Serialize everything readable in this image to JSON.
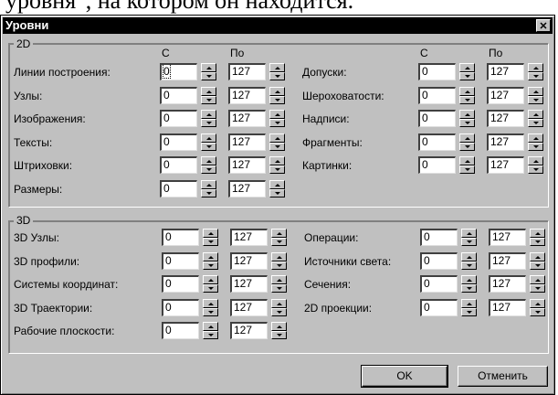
{
  "doc_text": "уровня\", на котором он находится.",
  "dialog": {
    "title": "Уровни",
    "close_glyph": "✕",
    "ok_label": "OK",
    "cancel_label": "Отменить"
  },
  "group_2d": {
    "label": "2D",
    "col_from": "С",
    "col_to": "По",
    "col_from_right": "С",
    "col_to_right": "По",
    "left_rows": [
      {
        "label": "Линии построения:",
        "from": "0",
        "to": "127"
      },
      {
        "label": "Узлы:",
        "from": "0",
        "to": "127"
      },
      {
        "label": "Изображения:",
        "from": "0",
        "to": "127"
      },
      {
        "label": "Тексты:",
        "from": "0",
        "to": "127"
      },
      {
        "label": "Штриховки:",
        "from": "0",
        "to": "127"
      },
      {
        "label": "Размеры:",
        "from": "0",
        "to": "127"
      }
    ],
    "right_rows": [
      {
        "label": "Допуски:",
        "from": "0",
        "to": "127"
      },
      {
        "label": "Шероховатости:",
        "from": "0",
        "to": "127"
      },
      {
        "label": "Надписи:",
        "from": "0",
        "to": "127"
      },
      {
        "label": "Фрагменты:",
        "from": "0",
        "to": "127"
      },
      {
        "label": "Картинки:",
        "from": "0",
        "to": "127"
      }
    ]
  },
  "group_3d": {
    "label": "3D",
    "left_rows": [
      {
        "label": "3D Узлы:",
        "from": "0",
        "to": "127"
      },
      {
        "label": "3D профили:",
        "from": "0",
        "to": "127"
      },
      {
        "label": "Системы координат:",
        "from": "0",
        "to": "127"
      },
      {
        "label": "3D Траектории:",
        "from": "0",
        "to": "127"
      },
      {
        "label": "Рабочие плоскости:",
        "from": "0",
        "to": "127"
      }
    ],
    "right_rows": [
      {
        "label": "Операции:",
        "from": "0",
        "to": "127"
      },
      {
        "label": "Источники света:",
        "from": "0",
        "to": "127"
      },
      {
        "label": "Сечения:",
        "from": "0",
        "to": "127"
      },
      {
        "label": "2D проекции:",
        "from": "0",
        "to": "127"
      }
    ]
  }
}
